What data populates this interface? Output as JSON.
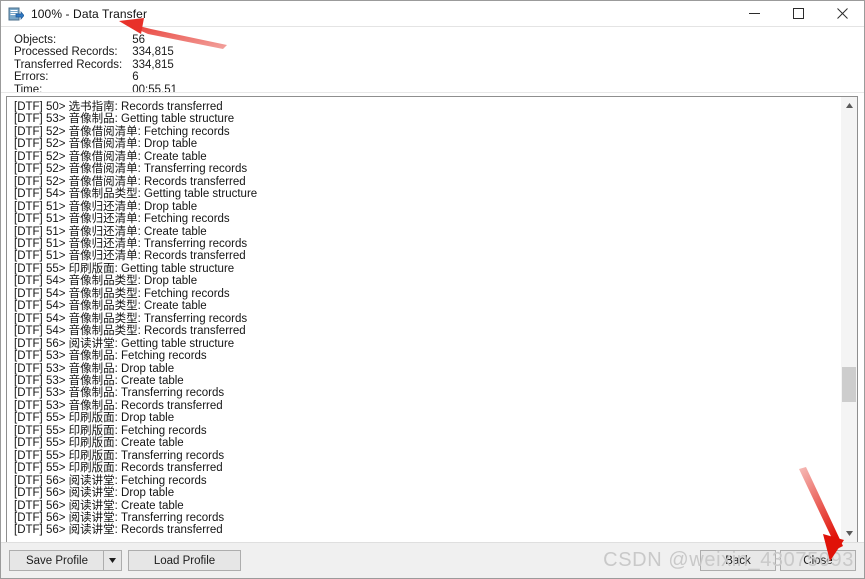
{
  "window": {
    "title": "100% - Data Transfer",
    "icon": "data-transfer-icon",
    "controls": {
      "minimize": "–",
      "maximize": "☐",
      "close": "✕"
    }
  },
  "stats": {
    "rows": [
      {
        "label": "Objects:",
        "value": "56"
      },
      {
        "label": "Processed Records:",
        "value": "334,815"
      },
      {
        "label": "Transferred Records:",
        "value": "334,815"
      },
      {
        "label": "Errors:",
        "value": "6"
      },
      {
        "label": "Time:",
        "value": "00:55.51"
      }
    ]
  },
  "log": {
    "lines": [
      "[DTF] 50> 选书指南: Records transferred",
      "[DTF] 53> 音像制品: Getting table structure",
      "[DTF] 52> 音像借阅清单: Fetching records",
      "[DTF] 52> 音像借阅清单: Drop table",
      "[DTF] 52> 音像借阅清单: Create table",
      "[DTF] 52> 音像借阅清单: Transferring records",
      "[DTF] 52> 音像借阅清单: Records transferred",
      "[DTF] 54> 音像制品类型: Getting table structure",
      "[DTF] 51> 音像归还清单: Drop table",
      "[DTF] 51> 音像归还清单: Fetching records",
      "[DTF] 51> 音像归还清单: Create table",
      "[DTF] 51> 音像归还清单: Transferring records",
      "[DTF] 51> 音像归还清单: Records transferred",
      "[DTF] 55> 印刷版面: Getting table structure",
      "[DTF] 54> 音像制品类型: Drop table",
      "[DTF] 54> 音像制品类型: Fetching records",
      "[DTF] 54> 音像制品类型: Create table",
      "[DTF] 54> 音像制品类型: Transferring records",
      "[DTF] 54> 音像制品类型: Records transferred",
      "[DTF] 56> 阅读讲堂: Getting table structure",
      "[DTF] 53> 音像制品: Fetching records",
      "[DTF] 53> 音像制品: Drop table",
      "[DTF] 53> 音像制品: Create table",
      "[DTF] 53> 音像制品: Transferring records",
      "[DTF] 53> 音像制品: Records transferred",
      "[DTF] 55> 印刷版面: Drop table",
      "[DTF] 55> 印刷版面: Fetching records",
      "[DTF] 55> 印刷版面: Create table",
      "[DTF] 55> 印刷版面: Transferring records",
      "[DTF] 55> 印刷版面: Records transferred",
      "[DTF] 56> 阅读讲堂: Fetching records",
      "[DTF] 56> 阅读讲堂: Drop table",
      "[DTF] 56> 阅读讲堂: Create table",
      "[DTF] 56> 阅读讲堂: Transferring records",
      "[DTF] 56> 阅读讲堂: Records transferred"
    ],
    "scroll": {
      "up_glyph": "▲",
      "down_glyph": "▼"
    }
  },
  "footer": {
    "save_profile": "Save Profile",
    "save_dropdown_glyph": "▼",
    "load_profile": "Load Profile",
    "back": "Back",
    "close": "Close"
  },
  "watermark": {
    "text": "CSDN @weixin_43075093"
  },
  "annotations": {
    "arrow_color": "#e8312a",
    "arrows": [
      {
        "name": "arrow-to-title",
        "target": "window-title"
      },
      {
        "name": "arrow-to-close-button",
        "target": "close-button"
      }
    ]
  },
  "colors": {
    "accent": "#e8312a",
    "window_bg": "#ffffff",
    "footer_bg": "#f0f0f0",
    "button_bg": "#e6e6e6",
    "border": "#8e8e8e",
    "watermark": "#c9c9c9"
  }
}
